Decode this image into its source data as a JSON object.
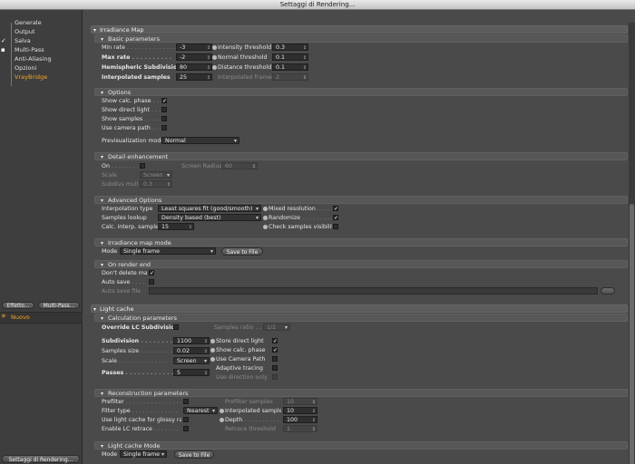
{
  "window": {
    "title": "Settaggi di Rendering..."
  },
  "sidebar": {
    "items": [
      "Generale",
      "Output",
      "Salva",
      "Multi-Pass",
      "Anti-Aliasing",
      "Opzioni",
      "VrayBridge"
    ],
    "effect_button": "Effetto...",
    "multipass_button": "Multi-Pass...",
    "preset_name": "Nuovo",
    "render_settings_button": "Settaggi di Rendering..."
  },
  "irr": {
    "title": "Irradiance Map",
    "basic": {
      "title": "Basic parameters",
      "min_rate": "Min rate",
      "min_rate_val": "-3",
      "max_rate": "Max rate",
      "max_rate_val": "-2",
      "hemi": "Hemispheric Subdivision",
      "hemi_val": "80",
      "interp": "Interpolated samples",
      "interp_val": "25",
      "intensity": "Intensity threshold",
      "intensity_val": "0.3",
      "normal": "Normal threshold",
      "normal_val": "0.1",
      "distance": "Distance threshold",
      "distance_val": "0.1",
      "interp_frames": "Interpolated frames",
      "interp_frames_val": "2"
    },
    "options": {
      "title": "Options",
      "show_calc": "Show calc. phase",
      "show_direct": "Show direct light",
      "show_samples": "Show samples",
      "use_camera": "Use camera path",
      "preview_mode": "Previsualization mode",
      "preview_val": "Normal"
    },
    "detail": {
      "title": "Detail enhancement",
      "on": "On",
      "screen_radius": "Screen Radius",
      "screen_radius_val": "60",
      "scale": "Scale",
      "scale_val": "Screen",
      "subdivs": "Subdivs mult.",
      "subdivs_val": "0.3"
    },
    "advanced": {
      "title": "Advanced Options",
      "interp_type": "Interpolation type",
      "interp_type_val": "Least squares fit (good/smooth)",
      "lookup": "Samples lookup",
      "lookup_val": "Density based (best)",
      "calc_interp": "Calc. interp. samples",
      "calc_interp_val": "15",
      "mixed": "Mixed resolution",
      "randomize": "Randomize",
      "check_vis": "Check samples visibility"
    },
    "mapmode": {
      "title": "Irradiance map mode",
      "mode": "Mode",
      "mode_val": "Single frame",
      "save": "Save to File"
    },
    "renderend": {
      "title": "On render end",
      "dont_delete": "Don't delete map",
      "auto_save": "Auto save",
      "auto_save_file": "Auto save file"
    }
  },
  "lc": {
    "title": "Light cache",
    "calc": {
      "title": "Calculation parameters",
      "override": "Override LC Subdivision",
      "samples_ratio": "Samples ratio",
      "samples_ratio_val": "1/2",
      "subdivision": "Subdivision",
      "subdivision_val": "1100",
      "sample_size": "Samples size",
      "sample_size_val": "0.02",
      "scale": "Scale",
      "scale_val": "Screen",
      "passes": "Passes",
      "passes_val": "5",
      "store_direct": "Store direct light",
      "show_calc": "Show calc. phase",
      "use_camera": "Use Camera Path",
      "adaptive": "Adaptive tracing",
      "use_dir": "Use direction only"
    },
    "recon": {
      "title": "Reconstruction parameters",
      "prefilter": "Prefilter",
      "prefilter_samples": "Prefilter samples",
      "prefilter_samples_val": "10",
      "filter_type": "Filter type",
      "filter_type_val": "Nearest",
      "interp_samples": "Interpolated samples",
      "interp_samples_val": "10",
      "glossy": "Use light cache for glossy rays",
      "depth": "Depth",
      "depth_val": "100",
      "lc_retrace": "Enable LC retrace",
      "retrace": "Retrace threshold",
      "retrace_val": "1"
    },
    "mode": {
      "title": "Light cache Mode",
      "mode": "Mode",
      "mode_val": "Single frame",
      "save": "Save to File"
    }
  }
}
